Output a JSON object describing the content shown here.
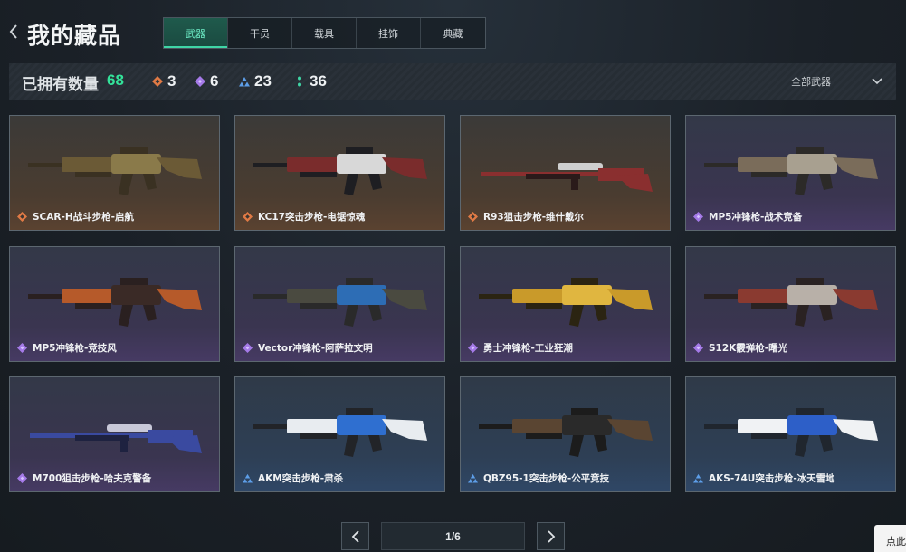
{
  "header": {
    "title": "我的藏品",
    "tabs": [
      {
        "label": "武器",
        "active": true
      },
      {
        "label": "干员",
        "active": false
      },
      {
        "label": "载具",
        "active": false
      },
      {
        "label": "挂饰",
        "active": false
      },
      {
        "label": "典藏",
        "active": false
      }
    ]
  },
  "stats": {
    "owned_label": "已拥有数量",
    "owned_count": "68",
    "rarity_counts": [
      {
        "icon": "orange-diamond-icon",
        "color": "#e07a45",
        "count": "3"
      },
      {
        "icon": "purple-diamond-icon",
        "color": "#a57ae8",
        "count": "6"
      },
      {
        "icon": "blue-triangle-icon",
        "color": "#5d9ee8",
        "count": "23"
      },
      {
        "icon": "green-dots-icon",
        "color": "#3fd6a6",
        "count": "36"
      }
    ],
    "filter_label": "全部武器"
  },
  "colors": {
    "accent_green": "#33e39a",
    "rarity_orange": "#e07a45",
    "rarity_purple": "#a57ae8",
    "rarity_blue": "#5d9ee8"
  },
  "items": [
    {
      "name": "SCAR-H战斗步枪-启航",
      "rarity": "orange"
    },
    {
      "name": "KC17突击步枪-电锯惊魂",
      "rarity": "orange"
    },
    {
      "name": "R93狙击步枪-维什戴尔",
      "rarity": "orange"
    },
    {
      "name": "MP5冲锋枪-战术竞备",
      "rarity": "purple"
    },
    {
      "name": "MP5冲锋枪-竞技风",
      "rarity": "purple"
    },
    {
      "name": "Vector冲锋枪-阿萨拉文明",
      "rarity": "purple"
    },
    {
      "name": "勇士冲锋枪-工业狂潮",
      "rarity": "purple"
    },
    {
      "name": "S12K霰弹枪-曙光",
      "rarity": "purple"
    },
    {
      "name": "M700狙击步枪-哈夫克警备",
      "rarity": "purple"
    },
    {
      "name": "AKM突击步枪-肃杀",
      "rarity": "blue"
    },
    {
      "name": "QBZ95-1突击步枪-公平竞技",
      "rarity": "blue"
    },
    {
      "name": "AKS-74U突击步枪-冰天雪地",
      "rarity": "blue"
    }
  ],
  "pagination": {
    "current": "1/6"
  },
  "corner_popup": "点此"
}
